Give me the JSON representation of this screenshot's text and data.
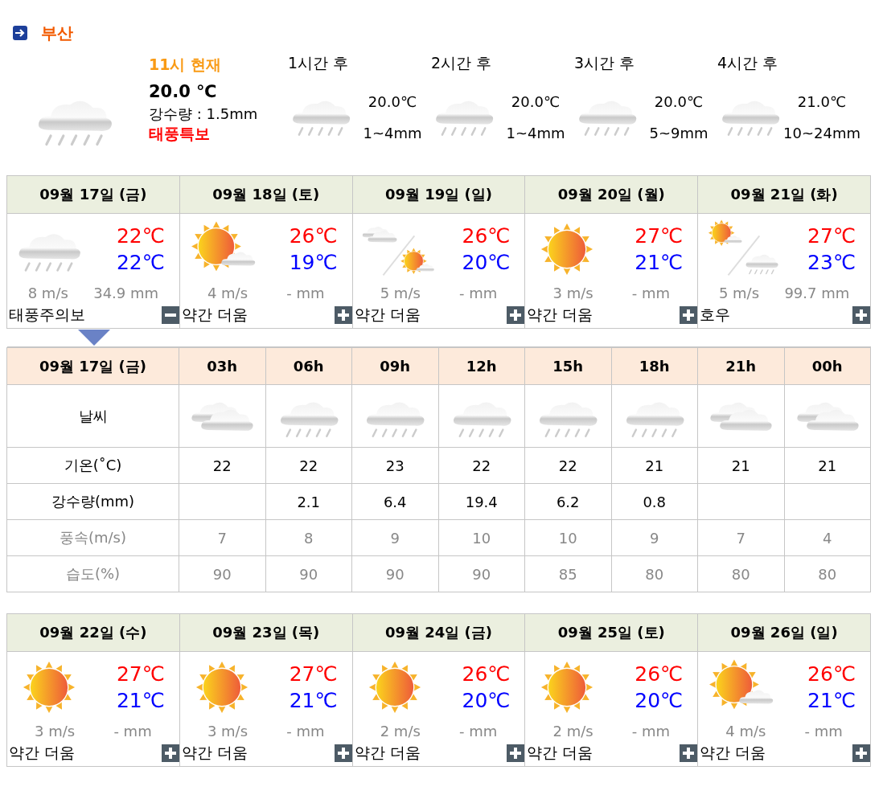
{
  "location": "부산",
  "current": {
    "time_label": "11시 현재",
    "temperature": "20.0 ℃",
    "precipitation": "강수량 : 1.5mm",
    "alert": "태풍특보",
    "kind": "rain"
  },
  "hour_forecasts": [
    {
      "label": "1시간 후",
      "temperature": "20.0℃",
      "precipitation": "1~4mm",
      "kind": "rain"
    },
    {
      "label": "2시간 후",
      "temperature": "20.0℃",
      "precipitation": "1~4mm",
      "kind": "rain"
    },
    {
      "label": "3시간 후",
      "temperature": "20.0℃",
      "precipitation": "5~9mm",
      "kind": "rain"
    },
    {
      "label": "4시간 후",
      "temperature": "21.0℃",
      "precipitation": "10~24mm",
      "kind": "rain"
    }
  ],
  "forecast_days": [
    {
      "date": "09월 17일 (금)",
      "high": "22℃",
      "low": "22℃",
      "wind": "8 m/s",
      "precipitation": "34.9 mm",
      "note": "태풍주의보",
      "expanded": true,
      "kind": "rain"
    },
    {
      "date": "09월 18일 (토)",
      "high": "26℃",
      "low": "19℃",
      "wind": "4 m/s",
      "precipitation": "- mm",
      "note": "약간 더움",
      "expanded": false,
      "kind": "suncloud"
    },
    {
      "date": "09월 19일 (일)",
      "high": "26℃",
      "low": "20℃",
      "wind": "5 m/s",
      "precipitation": "- mm",
      "note": "약간 더움",
      "expanded": false,
      "kind": "cloudythensuncloud"
    },
    {
      "date": "09월 20일 (월)",
      "high": "27℃",
      "low": "21℃",
      "wind": "3 m/s",
      "precipitation": "- mm",
      "note": "약간 더움",
      "expanded": false,
      "kind": "sunny"
    },
    {
      "date": "09월 21일 (화)",
      "high": "27℃",
      "low": "23℃",
      "wind": "5 m/s",
      "precipitation": "99.7 mm",
      "note": "호우",
      "expanded": false,
      "kind": "suncloudthenrain"
    }
  ],
  "hourly": {
    "date": "09월 17일 (금)",
    "row_labels": [
      {
        "label": "날씨",
        "kind": "main"
      },
      {
        "label": "기온(˚C)",
        "kind": "main"
      },
      {
        "label": "강수량(mm)",
        "kind": "main"
      },
      {
        "label": "풍속(m/s)",
        "kind": "secondary"
      },
      {
        "label": "습도(%)",
        "kind": "secondary"
      }
    ],
    "hours": [
      {
        "label": "03h",
        "kind": "cloudy",
        "temperature": "22",
        "wind": "7",
        "humidity": "90"
      },
      {
        "label": "06h",
        "kind": "rain",
        "temperature": "22",
        "precipitation": "2.1",
        "wind": "8",
        "humidity": "90"
      },
      {
        "label": "09h",
        "kind": "rain",
        "temperature": "23",
        "precipitation": "6.4",
        "wind": "9",
        "humidity": "90"
      },
      {
        "label": "12h",
        "kind": "rain",
        "temperature": "22",
        "precipitation": "19.4",
        "wind": "10",
        "humidity": "90"
      },
      {
        "label": "15h",
        "kind": "rain",
        "temperature": "22",
        "precipitation": "6.2",
        "wind": "10",
        "humidity": "85"
      },
      {
        "label": "18h",
        "kind": "rain",
        "temperature": "21",
        "precipitation": "0.8",
        "wind": "9",
        "humidity": "80"
      },
      {
        "label": "21h",
        "kind": "cloudy",
        "temperature": "21",
        "wind": "7",
        "humidity": "80"
      },
      {
        "label": "00h",
        "kind": "cloudy",
        "temperature": "21",
        "wind": "4",
        "humidity": "80"
      }
    ]
  },
  "forecast_days_later": [
    {
      "date": "09월 22일 (수)",
      "high": "27℃",
      "low": "21℃",
      "wind": "3 m/s",
      "precipitation": "- mm",
      "note": "약간 더움",
      "expanded": false,
      "kind": "sunny"
    },
    {
      "date": "09월 23일 (목)",
      "high": "27℃",
      "low": "21℃",
      "wind": "3 m/s",
      "precipitation": "- mm",
      "note": "약간 더움",
      "expanded": false,
      "kind": "sunny"
    },
    {
      "date": "09월 24일 (금)",
      "high": "26℃",
      "low": "20℃",
      "wind": "2 m/s",
      "precipitation": "- mm",
      "note": "약간 더움",
      "expanded": false,
      "kind": "sunny"
    },
    {
      "date": "09월 25일 (토)",
      "high": "26℃",
      "low": "20℃",
      "wind": "2 m/s",
      "precipitation": "- mm",
      "note": "약간 더움",
      "expanded": false,
      "kind": "sunny"
    },
    {
      "date": "09월 26일 (일)",
      "high": "26℃",
      "low": "21℃",
      "wind": "4 m/s",
      "precipitation": "- mm",
      "note": "약간 더움",
      "expanded": false,
      "kind": "suncloud"
    }
  ]
}
